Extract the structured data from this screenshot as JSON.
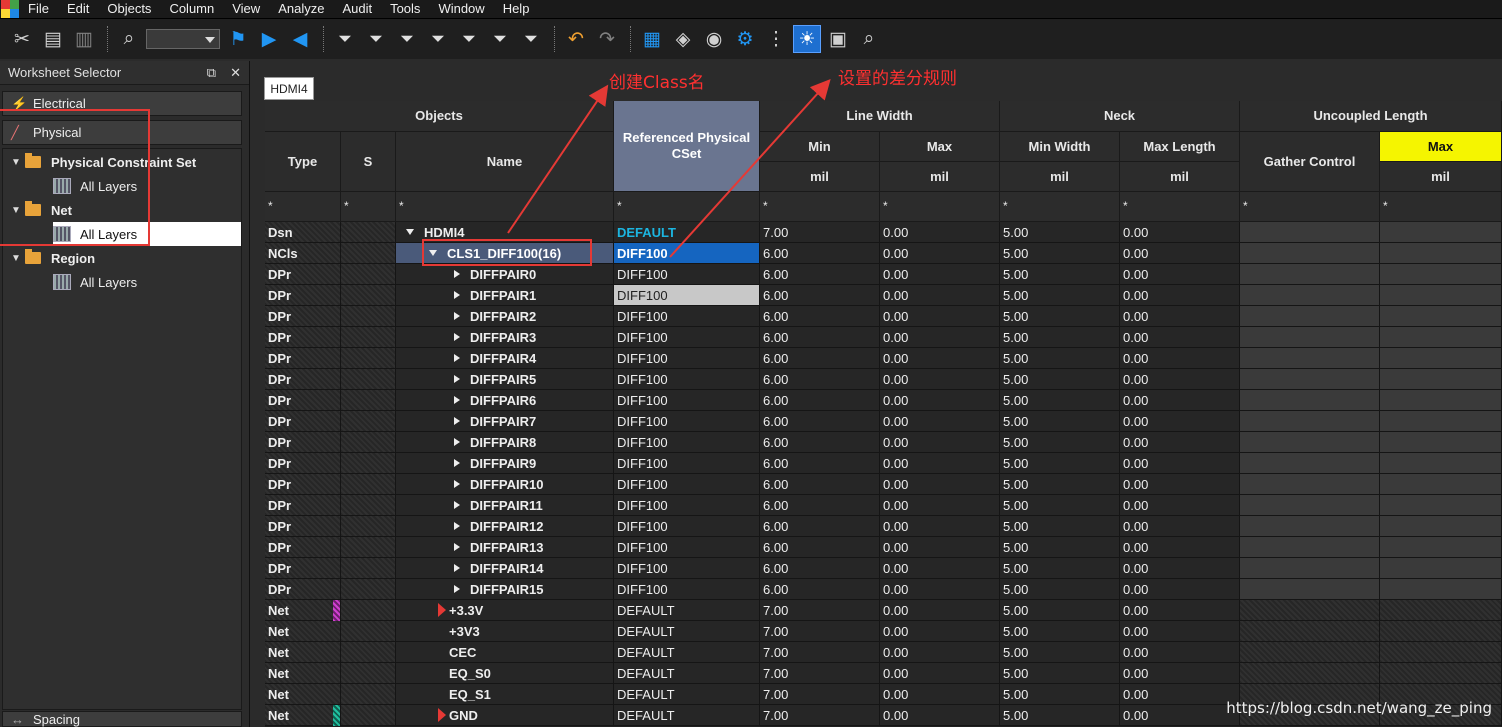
{
  "menu": [
    "File",
    "Edit",
    "Objects",
    "Column",
    "View",
    "Analyze",
    "Audit",
    "Tools",
    "Window",
    "Help"
  ],
  "toolbar_icons": [
    "cut-icon",
    "copy-icon",
    "paste-icon",
    "find-icon",
    "bookmark-icon",
    "bookmark-next-icon",
    "bookmark-prev-icon",
    "filter-icon",
    "filter-icon",
    "filter-warning-icon",
    "filter-icon",
    "filter-icon",
    "filter-icon",
    "filter-icon",
    "undo-icon",
    "redo-icon",
    "worksheet-icon",
    "hide-icon",
    "show-icon",
    "settings-icon",
    "net-icon",
    "sun-icon",
    "report-icon",
    "search-icon"
  ],
  "selector": {
    "title": "Worksheet Selector",
    "sections": {
      "electrical": "Electrical",
      "physical": "Physical",
      "spacing": "Spacing"
    },
    "tree": [
      {
        "label": "Physical Constraint Set",
        "child": "All Layers"
      },
      {
        "label": "Net",
        "child": "All Layers"
      },
      {
        "label": "Region",
        "child": "All Layers"
      }
    ]
  },
  "tab": "HDMI4",
  "grid": {
    "headers": {
      "objects": "Objects",
      "type": "Type",
      "s": "S",
      "name": "Name",
      "refcs": "Referenced Physical CSet",
      "line_width": "Line Width",
      "min": "Min",
      "max": "Max",
      "neck": "Neck",
      "min_width": "Min Width",
      "max_length": "Max Length",
      "uncoupled": "Uncoupled Length",
      "gather": "Gather Control",
      "ulmax": "Max",
      "unit": "mil",
      "filter": "*"
    },
    "rows": [
      {
        "type": "Dsn",
        "name": "HDMI4",
        "cset": "DEFAULT",
        "min": "7.00",
        "max": "0.00",
        "nmin": "5.00",
        "nmax": "0.00"
      },
      {
        "type": "NCls",
        "name": "CLS1_DIFF100(16)",
        "cset": "DIFF100",
        "min": "6.00",
        "max": "0.00",
        "nmin": "5.00",
        "nmax": "0.00"
      },
      {
        "type": "DPr",
        "name": "DIFFPAIR0",
        "cset": "DIFF100",
        "min": "6.00",
        "max": "0.00",
        "nmin": "5.00",
        "nmax": "0.00"
      },
      {
        "type": "DPr",
        "name": "DIFFPAIR1",
        "cset": "DIFF100",
        "min": "6.00",
        "max": "0.00",
        "nmin": "5.00",
        "nmax": "0.00"
      },
      {
        "type": "DPr",
        "name": "DIFFPAIR2",
        "cset": "DIFF100",
        "min": "6.00",
        "max": "0.00",
        "nmin": "5.00",
        "nmax": "0.00"
      },
      {
        "type": "DPr",
        "name": "DIFFPAIR3",
        "cset": "DIFF100",
        "min": "6.00",
        "max": "0.00",
        "nmin": "5.00",
        "nmax": "0.00"
      },
      {
        "type": "DPr",
        "name": "DIFFPAIR4",
        "cset": "DIFF100",
        "min": "6.00",
        "max": "0.00",
        "nmin": "5.00",
        "nmax": "0.00"
      },
      {
        "type": "DPr",
        "name": "DIFFPAIR5",
        "cset": "DIFF100",
        "min": "6.00",
        "max": "0.00",
        "nmin": "5.00",
        "nmax": "0.00"
      },
      {
        "type": "DPr",
        "name": "DIFFPAIR6",
        "cset": "DIFF100",
        "min": "6.00",
        "max": "0.00",
        "nmin": "5.00",
        "nmax": "0.00"
      },
      {
        "type": "DPr",
        "name": "DIFFPAIR7",
        "cset": "DIFF100",
        "min": "6.00",
        "max": "0.00",
        "nmin": "5.00",
        "nmax": "0.00"
      },
      {
        "type": "DPr",
        "name": "DIFFPAIR8",
        "cset": "DIFF100",
        "min": "6.00",
        "max": "0.00",
        "nmin": "5.00",
        "nmax": "0.00"
      },
      {
        "type": "DPr",
        "name": "DIFFPAIR9",
        "cset": "DIFF100",
        "min": "6.00",
        "max": "0.00",
        "nmin": "5.00",
        "nmax": "0.00"
      },
      {
        "type": "DPr",
        "name": "DIFFPAIR10",
        "cset": "DIFF100",
        "min": "6.00",
        "max": "0.00",
        "nmin": "5.00",
        "nmax": "0.00"
      },
      {
        "type": "DPr",
        "name": "DIFFPAIR11",
        "cset": "DIFF100",
        "min": "6.00",
        "max": "0.00",
        "nmin": "5.00",
        "nmax": "0.00"
      },
      {
        "type": "DPr",
        "name": "DIFFPAIR12",
        "cset": "DIFF100",
        "min": "6.00",
        "max": "0.00",
        "nmin": "5.00",
        "nmax": "0.00"
      },
      {
        "type": "DPr",
        "name": "DIFFPAIR13",
        "cset": "DIFF100",
        "min": "6.00",
        "max": "0.00",
        "nmin": "5.00",
        "nmax": "0.00"
      },
      {
        "type": "DPr",
        "name": "DIFFPAIR14",
        "cset": "DIFF100",
        "min": "6.00",
        "max": "0.00",
        "nmin": "5.00",
        "nmax": "0.00"
      },
      {
        "type": "DPr",
        "name": "DIFFPAIR15",
        "cset": "DIFF100",
        "min": "6.00",
        "max": "0.00",
        "nmin": "5.00",
        "nmax": "0.00"
      },
      {
        "type": "Net",
        "name": "+3.3V",
        "cset": "DEFAULT",
        "min": "7.00",
        "max": "0.00",
        "nmin": "5.00",
        "nmax": "0.00"
      },
      {
        "type": "Net",
        "name": "+3V3",
        "cset": "DEFAULT",
        "min": "7.00",
        "max": "0.00",
        "nmin": "5.00",
        "nmax": "0.00"
      },
      {
        "type": "Net",
        "name": "CEC",
        "cset": "DEFAULT",
        "min": "7.00",
        "max": "0.00",
        "nmin": "5.00",
        "nmax": "0.00"
      },
      {
        "type": "Net",
        "name": "EQ_S0",
        "cset": "DEFAULT",
        "min": "7.00",
        "max": "0.00",
        "nmin": "5.00",
        "nmax": "0.00"
      },
      {
        "type": "Net",
        "name": "EQ_S1",
        "cset": "DEFAULT",
        "min": "7.00",
        "max": "0.00",
        "nmin": "5.00",
        "nmax": "0.00"
      },
      {
        "type": "Net",
        "name": "GND",
        "cset": "DEFAULT",
        "min": "7.00",
        "max": "0.00",
        "nmin": "5.00",
        "nmax": "0.00"
      }
    ]
  },
  "annotations": {
    "create_class": "创建Class名",
    "diff_rule": "设置的差分规则"
  },
  "watermark": "https://blog.csdn.net/wang_ze_ping",
  "colors": {
    "accent_blue": "#1565c0",
    "highlight_yellow": "#f5f500",
    "annotation_red": "#e53935",
    "default_teal": "#1cb5e0"
  }
}
